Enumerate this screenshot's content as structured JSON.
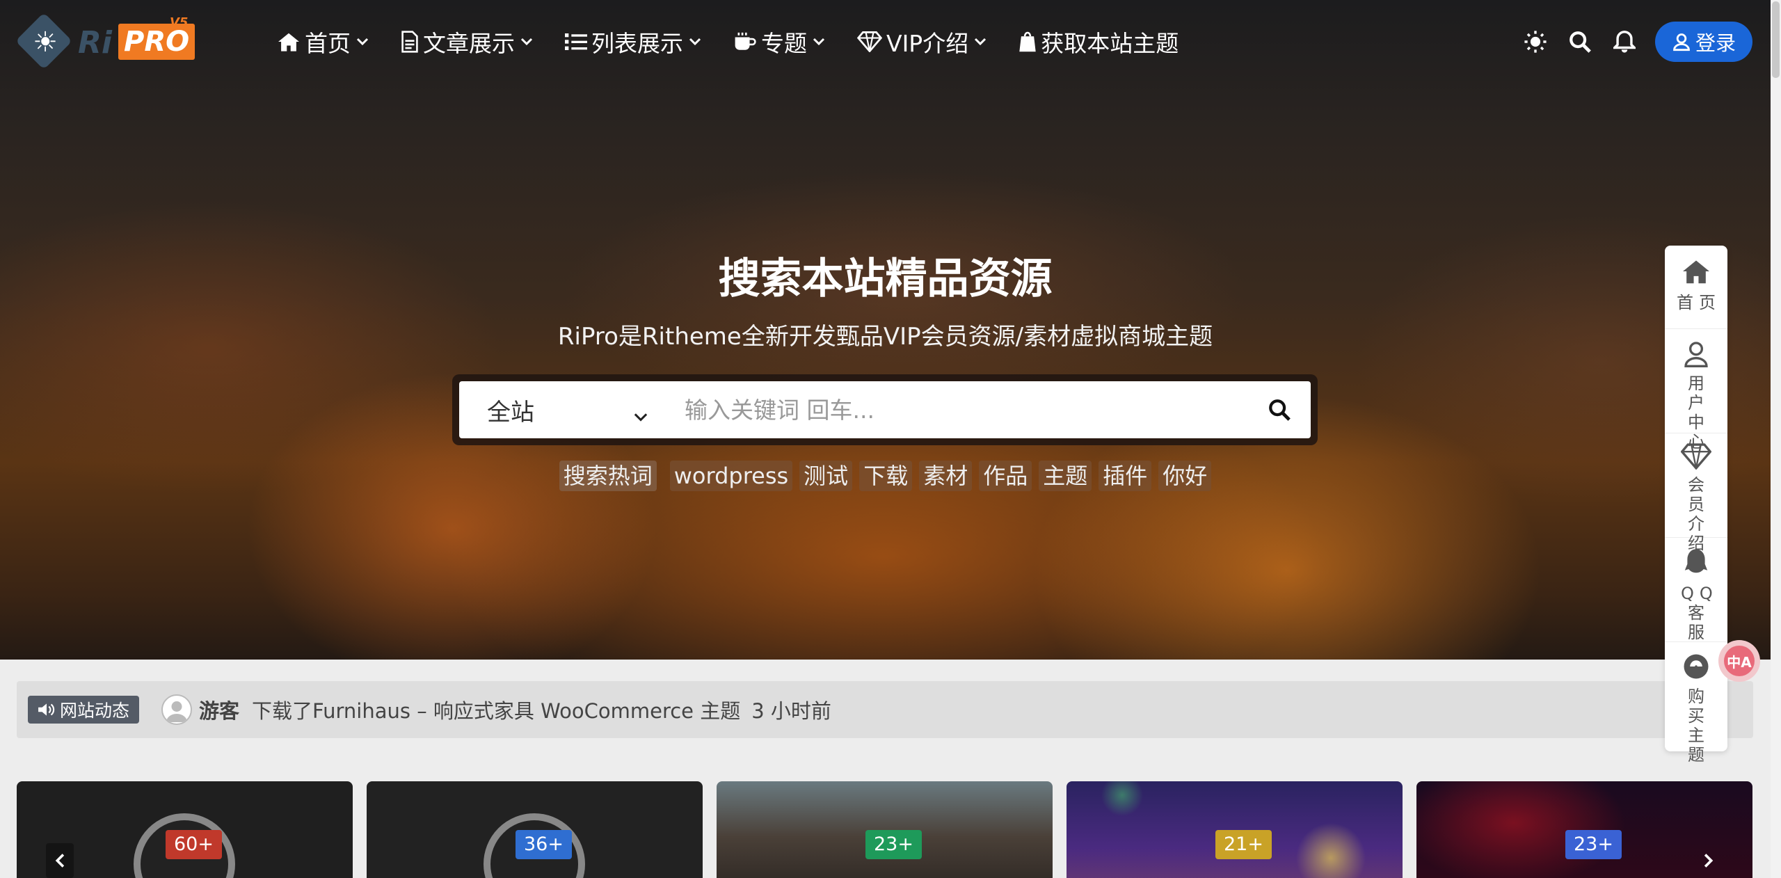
{
  "header": {
    "logo": {
      "ri": "Ri",
      "pro": "PRO",
      "version": "V5"
    },
    "nav": [
      {
        "label": "首页",
        "icon": "home-icon"
      },
      {
        "label": "文章展示",
        "icon": "document-icon"
      },
      {
        "label": "列表展示",
        "icon": "list-icon"
      },
      {
        "label": "专题",
        "icon": "coffee-icon"
      },
      {
        "label": "VIP介绍",
        "icon": "diamond-icon"
      },
      {
        "label": "获取本站主题",
        "icon": "shopify-bag-icon"
      }
    ],
    "login_label": "登录"
  },
  "hero": {
    "title": "搜索本站精品资源",
    "subtitle": "RiPro是Ritheme全新开发甄品VIP会员资源/素材虚拟商城主题",
    "search": {
      "scope": "全站",
      "placeholder": "输入关键词 回车..."
    },
    "hot_label": "搜索热词",
    "hot_words": [
      "wordpress",
      "测试",
      "下载",
      "素材",
      "作品",
      "主题",
      "插件",
      "你好"
    ]
  },
  "float_menu": [
    {
      "label": "首页",
      "icon": "home-icon"
    },
    {
      "label": "用户中心",
      "icon": "user-icon"
    },
    {
      "label": "会员介绍",
      "icon": "diamond-icon"
    },
    {
      "label": "QQ客服",
      "icon": "qq-icon"
    },
    {
      "label": "购买主题",
      "icon": "shop-icon"
    }
  ],
  "activity": {
    "badge": "网站动态",
    "user": "游客",
    "text": "下载了Furnihaus – 响应式家具 WooCommerce 主题",
    "time": "3 小时前"
  },
  "cards": [
    {
      "count": "60+",
      "badge_color": "#c0392b"
    },
    {
      "count": "36+",
      "badge_color": "#2f6ed1"
    },
    {
      "count": "23+",
      "badge_color": "#1e9a5a"
    },
    {
      "count": "21+",
      "badge_color": "#c9a227"
    },
    {
      "count": "23+",
      "badge_color": "#3a62d4"
    }
  ],
  "translate_badge": "中A",
  "colors": {
    "accent": "#1a66d8",
    "logo_orange": "#f07a22",
    "logo_blue": "#3b5266"
  }
}
